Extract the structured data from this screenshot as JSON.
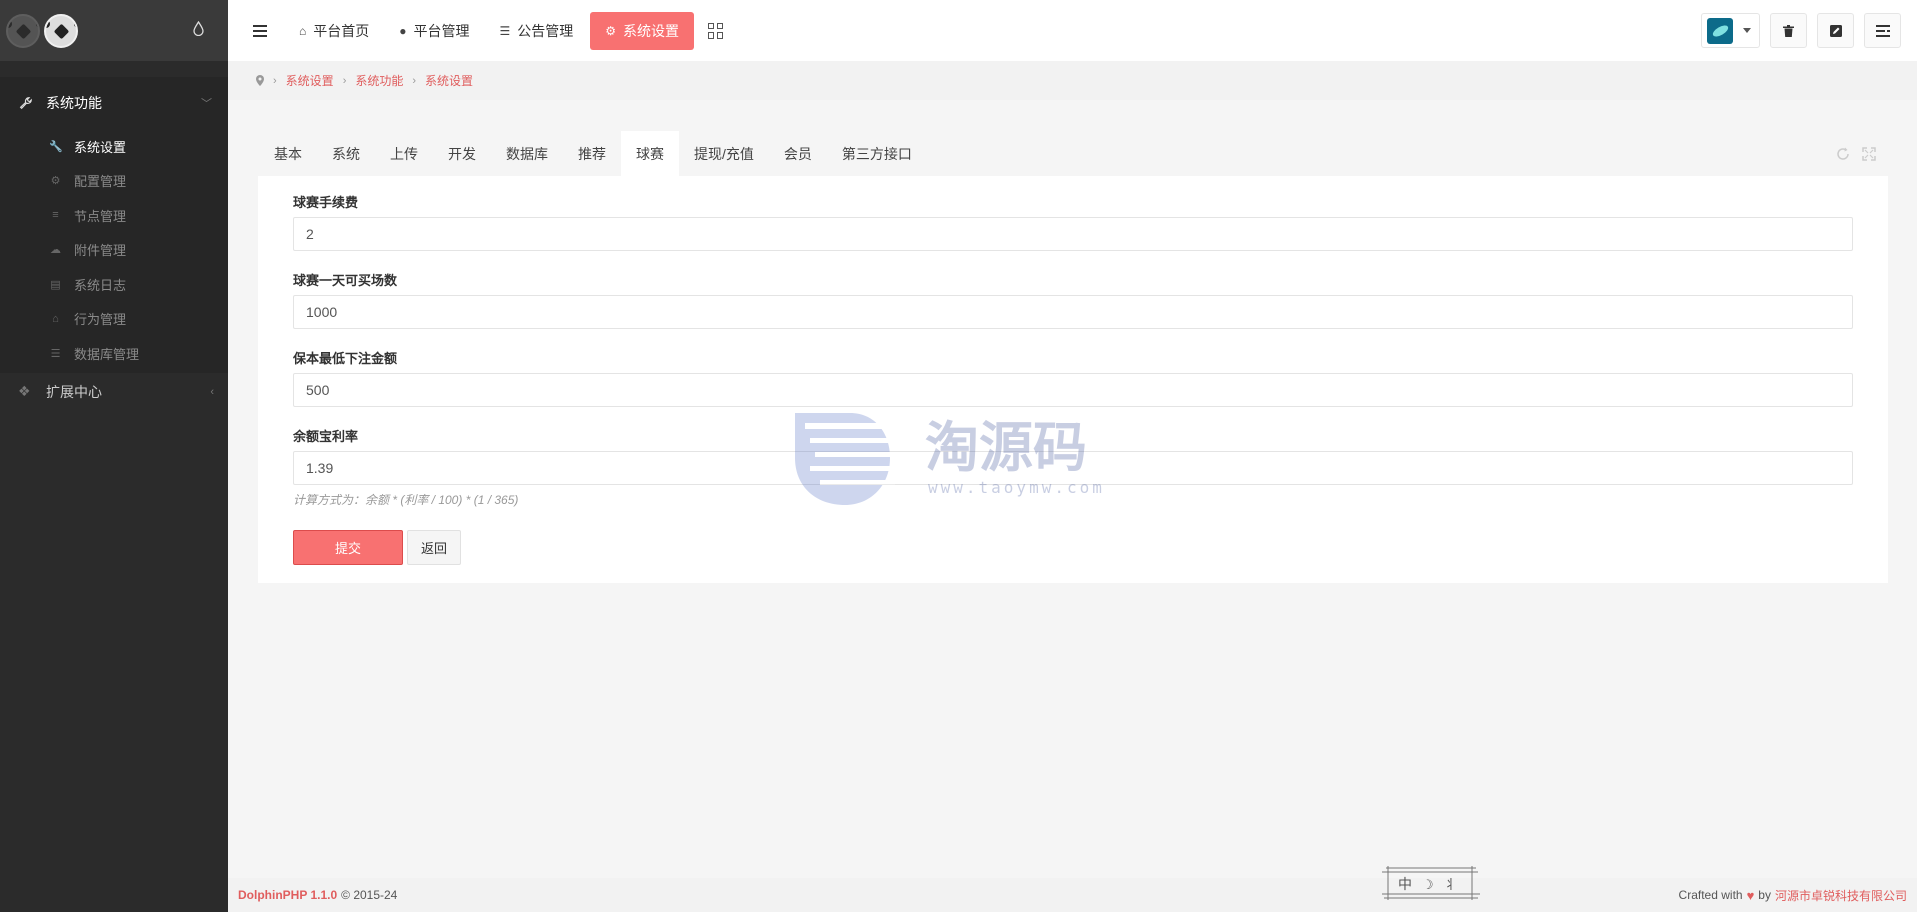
{
  "sidebar": {
    "menu1": {
      "label": "系统功能",
      "icon": "wrench-icon"
    },
    "items": [
      {
        "label": "系统设置",
        "icon": "wrench-icon",
        "active": true
      },
      {
        "label": "配置管理",
        "icon": "cogs-icon"
      },
      {
        "label": "节点管理",
        "icon": "list-icon"
      },
      {
        "label": "附件管理",
        "icon": "cloud-upload-icon"
      },
      {
        "label": "系统日志",
        "icon": "book-icon"
      },
      {
        "label": "行为管理",
        "icon": "home-icon"
      },
      {
        "label": "数据库管理",
        "icon": "database-icon"
      }
    ],
    "menu2": {
      "label": "扩展中心",
      "icon": "cubes-icon"
    }
  },
  "topnav": {
    "items": [
      {
        "label": "平台首页",
        "icon": "home-icon"
      },
      {
        "label": "平台管理",
        "icon": "user-icon"
      },
      {
        "label": "公告管理",
        "icon": "list-icon"
      },
      {
        "label": "系统设置",
        "icon": "gear-icon",
        "active": true
      }
    ]
  },
  "breadcrumb": [
    "系统设置",
    "系统功能",
    "系统设置"
  ],
  "tabs": [
    "基本",
    "系统",
    "上传",
    "开发",
    "数据库",
    "推荐",
    "球赛",
    "提现/充值",
    "会员",
    "第三方接口"
  ],
  "active_tab": "球赛",
  "form": {
    "fields": [
      {
        "label": "球赛手续费",
        "value": "2"
      },
      {
        "label": "球赛一天可买场数",
        "value": "1000"
      },
      {
        "label": "保本最低下注金额",
        "value": "500"
      },
      {
        "label": "余额宝利率",
        "value": "1.39",
        "help": "计算方式为：余额 * (利率 / 100) * (1 / 365)"
      }
    ],
    "submit": "提交",
    "back": "返回"
  },
  "watermark": {
    "text": "淘源码",
    "url": "www.taoymw.com"
  },
  "footer": {
    "brand": "DolphinPHP 1.1.0",
    "copyright": "© 2015-24",
    "crafted": "Crafted with",
    "by": "by",
    "company": "河源市卓锐科技有限公司"
  },
  "colors": {
    "accent": "#f87171",
    "sidebar": "#2b2b2b",
    "link": "#e05d5d"
  }
}
